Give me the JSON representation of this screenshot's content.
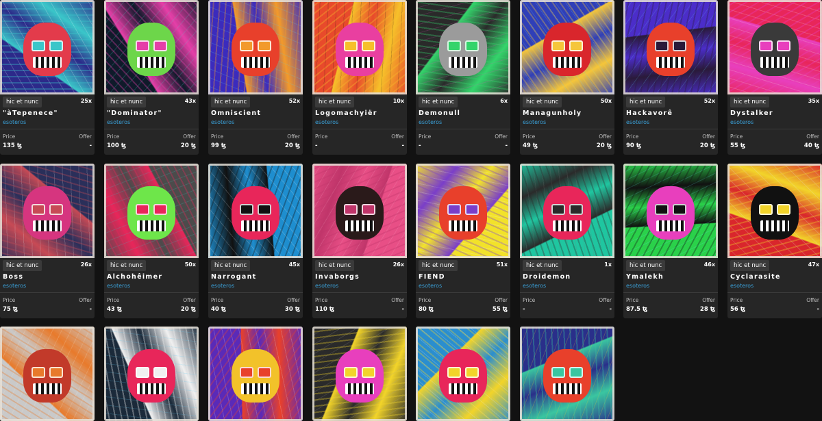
{
  "currency_symbol": "ꜩ",
  "cards": [
    {
      "platform": "hic et nunc",
      "editions": "25x",
      "title": "\"àTepenece\"",
      "artist": "esoteros",
      "price_label": "Price",
      "offer_label": "Offer",
      "price": "135 ꜩ",
      "offer": "-",
      "palette": [
        "#2c2a8a",
        "#e33b4b",
        "#3ac6c9",
        "#ffffff"
      ]
    },
    {
      "platform": "hic et nunc",
      "editions": "43x",
      "title": "\"Dominator\"",
      "artist": "esoteros",
      "price_label": "Price",
      "offer_label": "Offer",
      "price": "100 ꜩ",
      "offer": "20 ꜩ",
      "palette": [
        "#0f1a2a",
        "#6dd64a",
        "#e53fa8",
        "#42e0d0"
      ]
    },
    {
      "platform": "hic et nunc",
      "editions": "52x",
      "title": "Omniscient",
      "artist": "esoteros",
      "price_label": "Price",
      "offer_label": "Offer",
      "price": "99 ꜩ",
      "offer": "20 ꜩ",
      "palette": [
        "#3b2bbd",
        "#e8402b",
        "#f29a2b",
        "#51d1e6"
      ]
    },
    {
      "platform": "hic et nunc",
      "editions": "10x",
      "title": "Logomachyiër",
      "artist": "esoteros",
      "price_label": "Price",
      "offer_label": "Offer",
      "price": "-",
      "offer": "-",
      "palette": [
        "#e84a2b",
        "#e93fa0",
        "#f6c02a",
        "#111111"
      ]
    },
    {
      "platform": "hic et nunc",
      "editions": "6x",
      "title": "Demonull",
      "artist": "esoteros",
      "price_label": "Price",
      "offer_label": "Offer",
      "price": "-",
      "offer": "-",
      "palette": [
        "#2a2a2a",
        "#9b9b9b",
        "#34d46b",
        "#d84ab5"
      ]
    },
    {
      "platform": "hic et nunc",
      "editions": "50x",
      "title": "Managunholy",
      "artist": "esoteros",
      "price_label": "Price",
      "offer_label": "Offer",
      "price": "49 ꜩ",
      "offer": "20 ꜩ",
      "palette": [
        "#2f3fb8",
        "#d9262c",
        "#f5c63a",
        "#6fc8ef"
      ]
    },
    {
      "platform": "hic et nunc",
      "editions": "52x",
      "title": "Hackavorê",
      "artist": "esoteros",
      "price_label": "Price",
      "offer_label": "Offer",
      "price": "90 ꜩ",
      "offer": "20 ꜩ",
      "palette": [
        "#4b2dc9",
        "#e8402b",
        "#2a1a3a",
        "#58c7f2"
      ]
    },
    {
      "platform": "hic et nunc",
      "editions": "35x",
      "title": "Dystalker",
      "artist": "esoteros",
      "price_label": "Price",
      "offer_label": "Offer",
      "price": "55 ꜩ",
      "offer": "40 ꜩ",
      "palette": [
        "#e8265a",
        "#3a3a3a",
        "#e83fbd",
        "#f0e6e6"
      ]
    },
    {
      "platform": "hic et nunc",
      "editions": "26x",
      "title": "Boss",
      "artist": "esoteros",
      "price_label": "Price",
      "offer_label": "Offer",
      "price": "75 ꜩ",
      "offer": "-",
      "palette": [
        "#2a2f5a",
        "#d6357f",
        "#c74a55",
        "#e6e6e6"
      ]
    },
    {
      "platform": "hic et nunc",
      "editions": "50x",
      "title": "Alchohêimer",
      "artist": "esoteros",
      "price_label": "Price",
      "offer_label": "Offer",
      "price": "43 ꜩ",
      "offer": "20 ꜩ",
      "palette": [
        "#4b4b4b",
        "#6ee64a",
        "#e8265a",
        "#3ac6c9"
      ]
    },
    {
      "platform": "hic et nunc",
      "editions": "45x",
      "title": "Narrogant",
      "artist": "esoteros",
      "price_label": "Price",
      "offer_label": "Offer",
      "price": "40 ꜩ",
      "offer": "30 ꜩ",
      "palette": [
        "#1e8ecf",
        "#e8265a",
        "#111111",
        "#f0f0f0"
      ]
    },
    {
      "platform": "hic et nunc",
      "editions": "26x",
      "title": "Invaborgs",
      "artist": "esoteros",
      "price_label": "Price",
      "offer_label": "Offer",
      "price": "110 ꜩ",
      "offer": "-",
      "palette": [
        "#e84f86",
        "#2a1a1a",
        "#c0356a",
        "#f5a0c0"
      ]
    },
    {
      "platform": "hic et nunc",
      "editions": "51x",
      "title": "FIEND",
      "artist": "esoteros",
      "price_label": "Price",
      "offer_label": "Offer",
      "price": "80 ꜩ",
      "offer": "55 ꜩ",
      "palette": [
        "#f2e22a",
        "#e8402b",
        "#7a3ec9",
        "#f0f0f0"
      ]
    },
    {
      "platform": "hic et nunc",
      "editions": "1x",
      "title": "Droidemon",
      "artist": "esoteros",
      "price_label": "Price",
      "offer_label": "Offer",
      "price": "-",
      "offer": "-",
      "palette": [
        "#1fc6a0",
        "#e8265a",
        "#2a2a2a",
        "#7a7a7a"
      ]
    },
    {
      "platform": "hic et nunc",
      "editions": "46x",
      "title": "Ÿmalekh",
      "artist": "esoteros",
      "price_label": "Price",
      "offer_label": "Offer",
      "price": "87.5 ꜩ",
      "offer": "28 ꜩ",
      "palette": [
        "#2ad14a",
        "#e83fbd",
        "#111111",
        "#58e0e6"
      ]
    },
    {
      "platform": "hic et nunc",
      "editions": "47x",
      "title": "Cyclarasite",
      "artist": "esoteros",
      "price_label": "Price",
      "offer_label": "Offer",
      "price": "56 ꜩ",
      "offer": "-",
      "palette": [
        "#d9262c",
        "#111111",
        "#f2d42a",
        "#e6e6e6"
      ]
    },
    {
      "palette": [
        "#c9c9c9",
        "#c23a2a",
        "#e87a2b",
        "#f0e6d6"
      ]
    },
    {
      "palette": [
        "#1b2a3a",
        "#e8265a",
        "#f0f0f0",
        "#58c7f2"
      ]
    },
    {
      "palette": [
        "#5a2ab8",
        "#f2c22a",
        "#e8402b",
        "#f0f0f0"
      ]
    },
    {
      "palette": [
        "#2a2a2a",
        "#e83fbd",
        "#f2d42a",
        "#9b9b9b"
      ]
    },
    {
      "palette": [
        "#2a8ecf",
        "#e8265a",
        "#f2d42a",
        "#f0f0f0"
      ]
    },
    {
      "palette": [
        "#2a2f8a",
        "#e8402b",
        "#3ac6a0",
        "#f2d42a"
      ]
    }
  ]
}
